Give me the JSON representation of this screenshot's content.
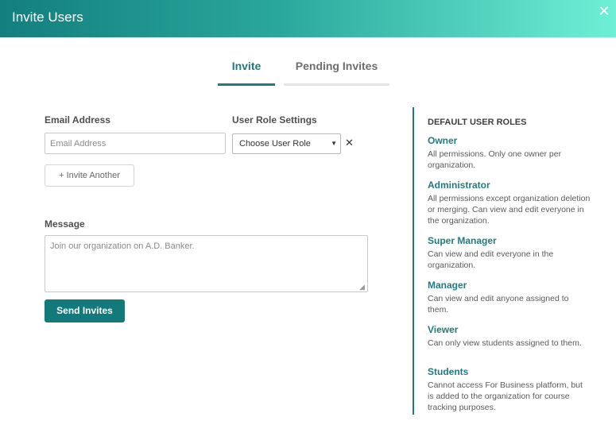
{
  "header": {
    "title": "Invite Users",
    "close_glyph": "✕"
  },
  "tabs": [
    {
      "label": "Invite",
      "active": true
    },
    {
      "label": "Pending Invites",
      "active": false
    }
  ],
  "form": {
    "email_label": "Email Address",
    "email_placeholder": "Email Address",
    "email_value": "",
    "role_label": "User Role Settings",
    "role_selected": "Choose User Role",
    "remove_glyph": "✕",
    "invite_another_label": "+ Invite Another",
    "message_label": "Message",
    "message_placeholder": "Join our organization on A.D. Banker.",
    "message_value": "",
    "send_label": "Send Invites"
  },
  "roles_panel": {
    "heading": "DEFAULT USER ROLES",
    "roles": [
      {
        "name": "Owner",
        "description": "All permissions. Only one owner per organization."
      },
      {
        "name": "Administrator",
        "description": "All permissions except organization deletion or merging. Can view and edit everyone in the organization."
      },
      {
        "name": "Super Manager",
        "description": "Can view and edit everyone in the organization."
      },
      {
        "name": "Manager",
        "description": "Can view and edit anyone assigned to them."
      },
      {
        "name": "Viewer",
        "description": "Can only view students assigned to them."
      },
      {
        "name": "Students",
        "description": "Cannot access For Business platform, but is added to the organization for course tracking purposes."
      }
    ]
  },
  "colors": {
    "accent": "#1f7b7e",
    "header_start": "#137f7e",
    "header_end": "#6ef0d6",
    "button": "#137a7c"
  }
}
